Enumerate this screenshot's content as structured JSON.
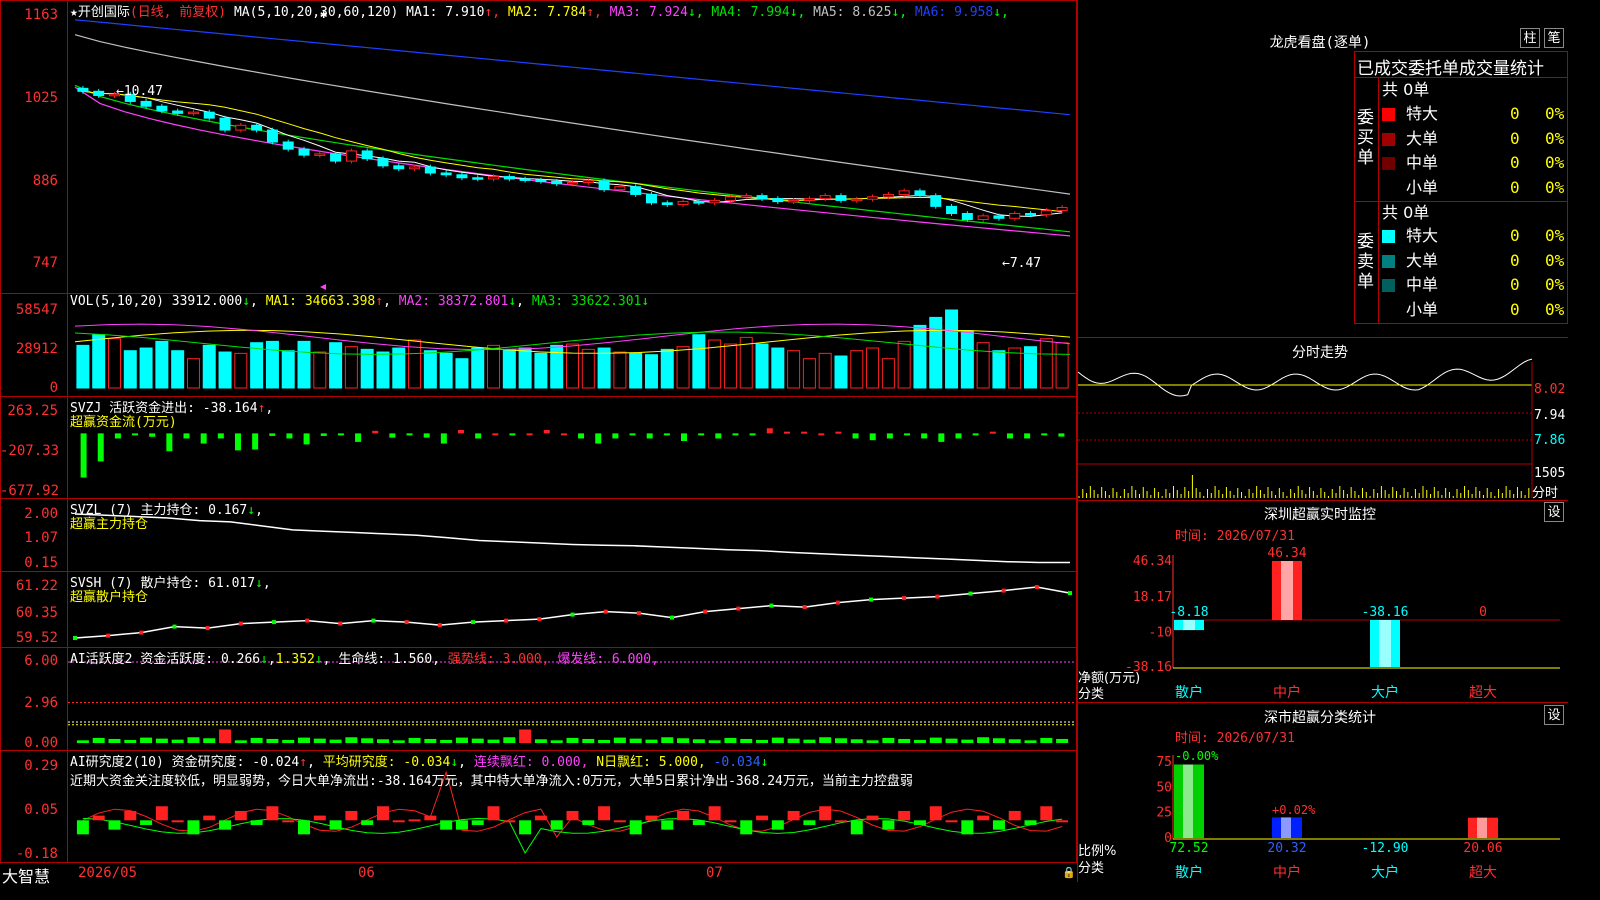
{
  "stock": {
    "title": "★开创国际",
    "period": "(日线, 前复权)",
    "ma_header": "MA(5,10,20,30,60,120)",
    "ma": [
      {
        "label": "MA1: 7.910",
        "arrow": "↑",
        "color": "#ffffff"
      },
      {
        "label": "MA2: 7.784",
        "arrow": "↑",
        "color": "#ffff00"
      },
      {
        "label": "MA3: 7.924",
        "arrow": "↓",
        "color": "#ff40ff"
      },
      {
        "label": "MA4: 7.994",
        "arrow": "↓",
        "color": "#00e000"
      },
      {
        "label": "MA5: 8.625",
        "arrow": "↓",
        "color": "#c0c0c0"
      },
      {
        "label": "MA6: 9.958",
        "arrow": "↓",
        "color": "#2040ff"
      }
    ],
    "price_axis": [
      "1163",
      "1025",
      "886",
      "747"
    ],
    "high_label": "←10.47",
    "low_label": "←7.47"
  },
  "vol": {
    "header": "VOL(5,10,20)",
    "value": "33912.000",
    "ma1": "MA1: 34663.398",
    "ma2": "MA2: 38372.801",
    "ma3": "MA3: 33622.301",
    "axis": [
      "58547",
      "28912",
      "0"
    ]
  },
  "svzj": {
    "header": "SVZJ  活跃资金进出: -38.164",
    "sub": "超赢资金流(万元)",
    "axis": [
      "263.25",
      "-207.33",
      "-677.92"
    ]
  },
  "svzl": {
    "header": "SVZL (7) 主力持仓: 0.167",
    "sub": "超赢主力持仓",
    "axis": [
      "2.00",
      "1.07",
      "0.15"
    ]
  },
  "svsh": {
    "header": "SVSH (7) 散户持仓: 61.017",
    "sub": "超赢散户持仓",
    "axis": [
      "61.22",
      "60.35",
      "59.52"
    ]
  },
  "ai1": {
    "header": "AI活跃度2 资金活跃度: 0.266",
    "v2": "1.352",
    "life": "生命线: 1.560,",
    "strong": "强势线: 3.000,",
    "burst": "爆发线: 6.000,",
    "axis": [
      "6.00",
      "2.96",
      "0.00"
    ]
  },
  "ai2": {
    "header": "AI研究度2(10) 资金研究度: -0.024",
    "avg": "平均研究度: -0.034",
    "streak": "连续飘红: 0.000,",
    "nday": "N日飘红: 5.000,",
    "neg": "-0.034",
    "comment": "近期大资金关注度较低，明显弱势，今日大单净流出:-38.164万元，其中特大单净流入:0万元，大单5日累计净出-368.24万元，当前主力控盘弱",
    "axis": [
      "0.29",
      "0.05",
      "-0.18"
    ]
  },
  "dates": {
    "d1": "2026/05",
    "d2": "06",
    "d3": "07"
  },
  "brand": "大智慧",
  "right": {
    "dragon_title": "龙虎看盘(逐单)",
    "btn_col": "柱",
    "btn_pen": "笔",
    "stat_title": "已成交委托单成交量统计",
    "buy_label": "委买单",
    "sell_label": "委卖单",
    "buy_total": "共 0单",
    "sell_total": "共 0单",
    "rows": [
      "特大",
      "大单",
      "中单",
      "小单"
    ],
    "zero": "0",
    "pct": "0%",
    "fenshi_title": "分时走势",
    "fenshi_axis": [
      "8.02",
      "7.94",
      "7.86"
    ],
    "fenshi_vol": "1505",
    "fenshi_unit": "分时",
    "sz_title": "深圳超赢实时监控",
    "set": "设",
    "time_label": "时间: 2026/07/31",
    "net_label": "净额(万元)",
    "cat_label": "分类",
    "categories": [
      "散户",
      "中户",
      "大户",
      "超大"
    ],
    "sz_axis": [
      "46.34",
      "18.17",
      "-10",
      "-38.16"
    ],
    "sz_values": [
      -8.18,
      46.34,
      -38.16,
      0
    ],
    "sz_value_labels": [
      "-8.18",
      "46.34",
      "-38.16",
      "0"
    ],
    "cls_title": "深市超赢分类统计",
    "cls_axis": [
      "75",
      "50",
      "25",
      "0"
    ],
    "ratio_label": "比例%",
    "cls_values": [
      72.52,
      20.32,
      -12.9,
      20.06
    ],
    "cls_value_labels": [
      "72.52",
      "20.32",
      "-12.90",
      "20.06"
    ],
    "cls_top_labels": [
      "-0.00%",
      "+0.02%"
    ]
  },
  "colors": {
    "up": "#ff2020",
    "down": "#00ffff",
    "grid": "#b00000"
  },
  "chart_data": [
    {
      "type": "candlestick",
      "title": "开创国际 (日线, 前复权)",
      "price_range": [
        7.47,
        10.47
      ],
      "ma_values": {
        "MA1": 7.91,
        "MA2": 7.784,
        "MA3": 7.924,
        "MA4": 7.994,
        "MA5": 8.625,
        "MA6": 9.958
      },
      "closes": [
        10.35,
        10.28,
        10.3,
        10.18,
        10.1,
        10.02,
        9.98,
        10.0,
        9.9,
        9.7,
        9.78,
        9.7,
        9.5,
        9.38,
        9.28,
        9.3,
        9.18,
        9.35,
        9.22,
        9.1,
        9.05,
        9.08,
        8.98,
        8.95,
        8.9,
        8.88,
        8.92,
        8.88,
        8.86,
        8.84,
        8.8,
        8.82,
        8.85,
        8.7,
        8.75,
        8.62,
        8.48,
        8.45,
        8.5,
        8.48,
        8.52,
        8.58,
        8.6,
        8.55,
        8.5,
        8.52,
        8.55,
        8.6,
        8.52,
        8.54,
        8.58,
        8.62,
        8.68,
        8.6,
        8.42,
        8.3,
        8.2,
        8.26,
        8.22,
        8.3,
        8.28,
        8.35,
        8.4
      ]
    },
    {
      "type": "bar",
      "title": "VOL(5,10,20)",
      "values": [
        32000,
        40000,
        37000,
        28000,
        30000,
        35000,
        28000,
        22000,
        32000,
        27000,
        26000,
        34000,
        35000,
        28000,
        35000,
        27000,
        34000,
        31000,
        29000,
        27000,
        30000,
        36000,
        28000,
        26000,
        22000,
        30000,
        32000,
        29000,
        30000,
        26000,
        32000,
        33000,
        29000,
        30000,
        27000,
        26000,
        25000,
        29000,
        31000,
        40000,
        36000,
        33000,
        38000,
        33000,
        30000,
        28000,
        22000,
        26000,
        24000,
        28000,
        30000,
        22000,
        35000,
        47000,
        53000,
        58547,
        43000,
        34000,
        28000,
        30000,
        31000,
        37000,
        33912
      ]
    },
    {
      "type": "bar",
      "title": "超赢资金流(万元)",
      "values": [
        -520,
        -330,
        -60,
        -10,
        -40,
        -210,
        -60,
        -120,
        -60,
        -200,
        -190,
        -30,
        -60,
        -130,
        -30,
        -20,
        -100,
        30,
        -50,
        -20,
        -50,
        -120,
        40,
        -60,
        0,
        -20,
        0,
        40,
        0,
        -60,
        -120,
        -60,
        -20,
        -60,
        -20,
        -90,
        -20,
        -60,
        -20,
        -20,
        60,
        20,
        20,
        0,
        20,
        -60,
        -80,
        -60,
        -20,
        -60,
        -100,
        -60,
        -20,
        20,
        -60,
        -60,
        -20,
        -38
      ]
    },
    {
      "type": "line",
      "title": "超赢主力持仓",
      "values": [
        2.0,
        1.95,
        1.9,
        1.85,
        1.75,
        1.7,
        1.55,
        1.4,
        1.35,
        1.3,
        1.25,
        1.2,
        1.1,
        1.0,
        0.95,
        0.9,
        0.85,
        0.82,
        0.8,
        0.75,
        0.7,
        0.65,
        0.62,
        0.55,
        0.5,
        0.45,
        0.4,
        0.35,
        0.3,
        0.25,
        0.2,
        0.17,
        0.167
      ]
    },
    {
      "type": "line",
      "title": "超赢散户持仓",
      "values": [
        59.52,
        59.6,
        59.7,
        59.9,
        59.85,
        60.0,
        60.05,
        60.1,
        60.0,
        60.1,
        60.05,
        59.95,
        60.05,
        60.1,
        60.15,
        60.3,
        60.4,
        60.35,
        60.2,
        60.4,
        60.5,
        60.6,
        60.55,
        60.7,
        60.8,
        60.85,
        60.9,
        61.0,
        61.1,
        61.22,
        61.017
      ]
    },
    {
      "type": "bar",
      "title": "深圳超赢实时监控",
      "categories": [
        "散户",
        "中户",
        "大户",
        "超大"
      ],
      "values": [
        -8.18,
        46.34,
        -38.16,
        0
      ]
    },
    {
      "type": "bar",
      "title": "深市超赢分类统计",
      "categories": [
        "散户",
        "中户",
        "大户",
        "超大"
      ],
      "values": [
        72.52,
        20.32,
        -12.9,
        20.06
      ],
      "ylim": [
        0,
        75
      ]
    }
  ]
}
